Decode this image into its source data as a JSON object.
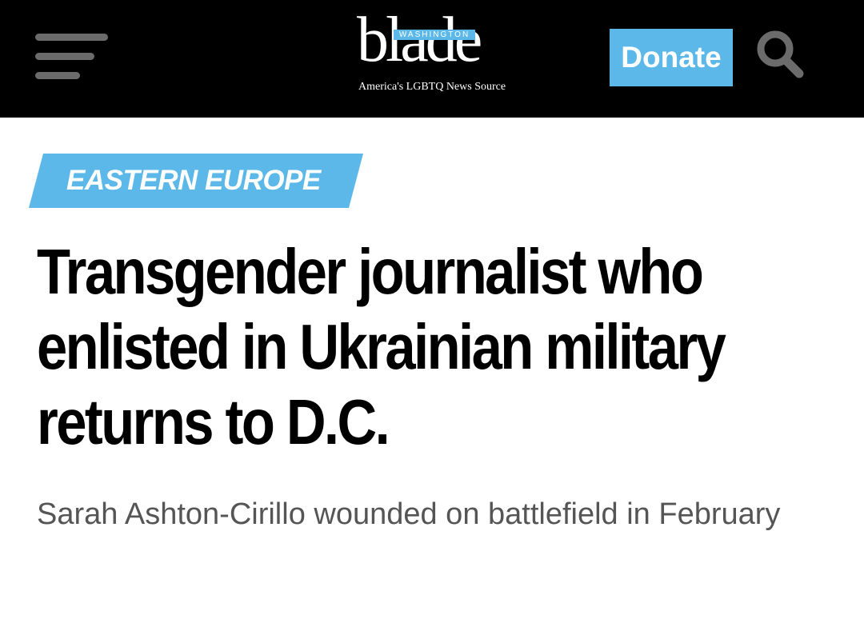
{
  "header": {
    "logo": {
      "wordmark": "blade",
      "top_label": "WASHINGTON",
      "tagline": "America's LGBTQ News Source"
    },
    "donate_label": "Donate",
    "icons": {
      "menu": "hamburger-menu-icon",
      "search": "search-icon"
    }
  },
  "article": {
    "category": "EASTERN EUROPE",
    "headline": "Transgender journalist who enlisted in Ukrainian military returns to D.C.",
    "subtitle": "Sarah Ashton-Cirillo wounded on battlefield in February"
  },
  "colors": {
    "header_bg": "#000000",
    "accent": "#5bb8e8",
    "menu_bars": "#6b6b6b",
    "headline": "#000000",
    "subtitle": "#555555"
  }
}
